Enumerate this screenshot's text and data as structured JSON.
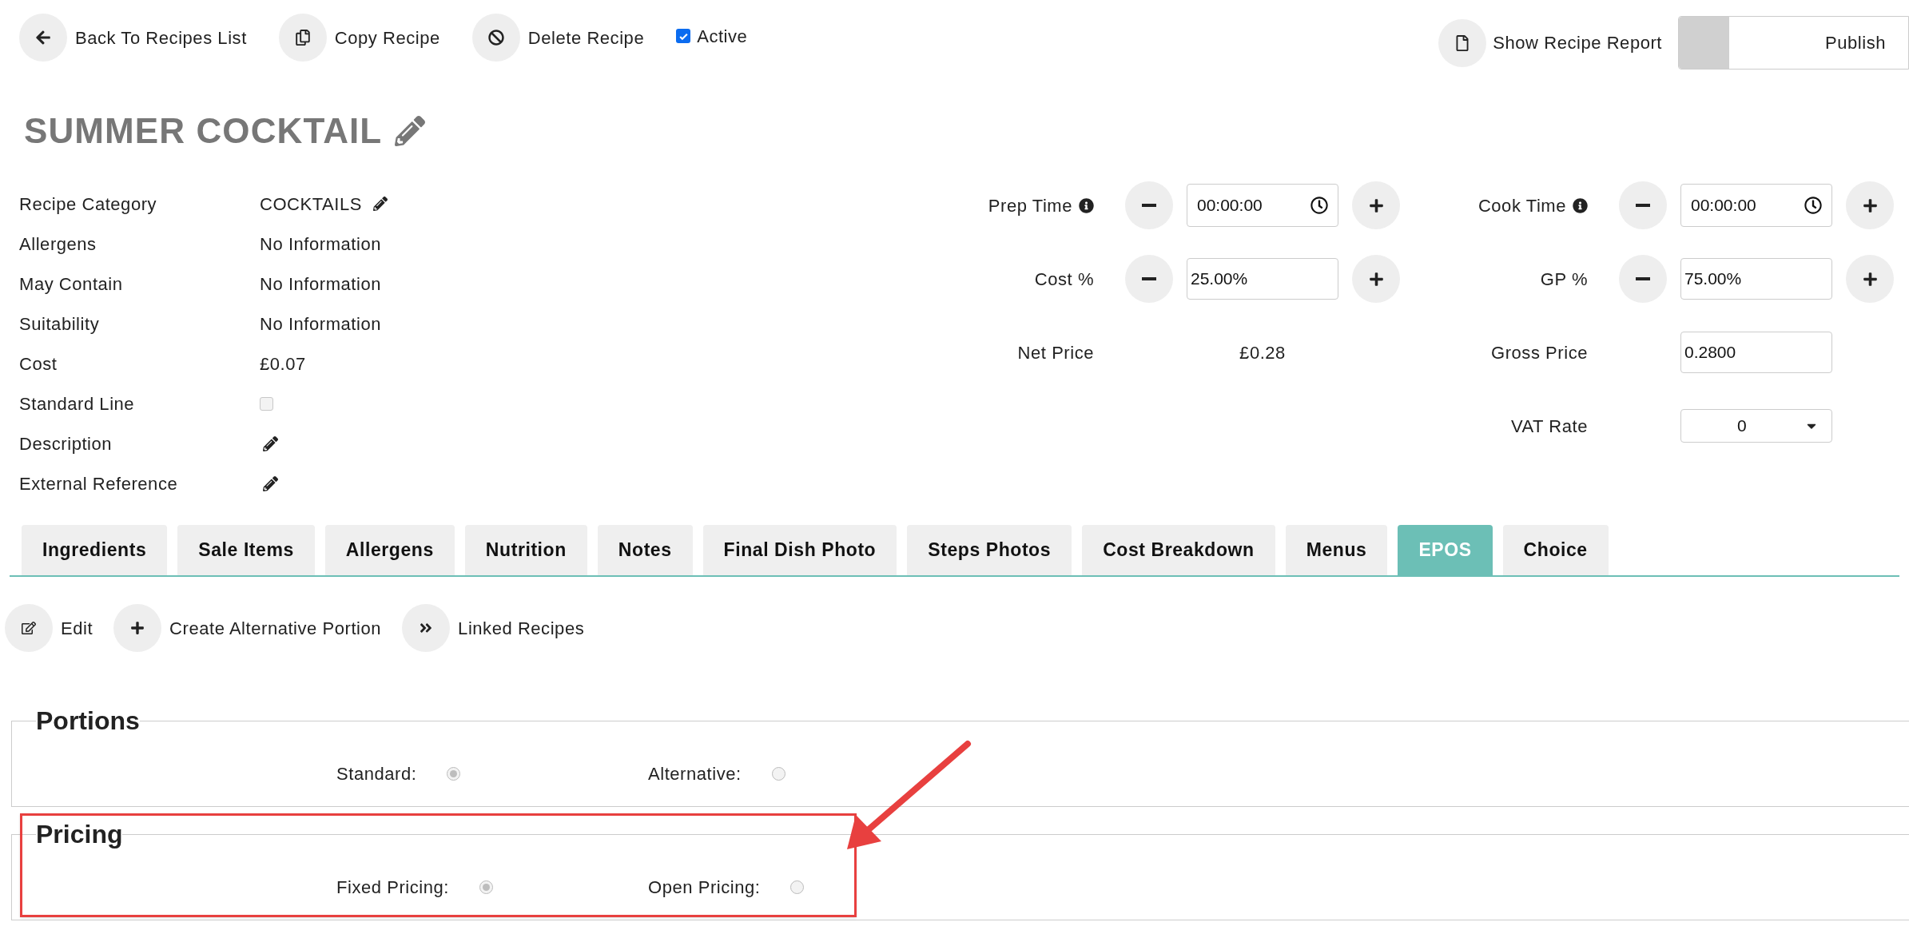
{
  "toolbar": {
    "buttons": [
      {
        "label": "Back To Recipes List"
      },
      {
        "label": "Copy Recipe"
      },
      {
        "label": "Delete Recipe"
      }
    ],
    "active": {
      "label": "Active",
      "checked": true
    },
    "report_button": {
      "label": "Show Recipe Report"
    },
    "publish_toggle": {
      "label": "Publish",
      "on": false
    }
  },
  "recipe_title": "SUMMER COCKTAIL",
  "details": [
    {
      "label": "Recipe Category",
      "kind": "text",
      "value": "COCKTAILS",
      "editable": true
    },
    {
      "label": "Allergens",
      "kind": "text",
      "value": "No Information",
      "editable": false
    },
    {
      "label": "May Contain",
      "kind": "text",
      "value": "No Information",
      "editable": false
    },
    {
      "label": "Suitability",
      "kind": "text",
      "value": "No Information",
      "editable": false
    },
    {
      "label": "Cost",
      "kind": "text",
      "value": "£0.07",
      "editable": false
    },
    {
      "label": "Standard Line",
      "kind": "checkbox",
      "checked": false
    },
    {
      "label": "Description",
      "kind": "edit"
    },
    {
      "label": "External Reference",
      "kind": "edit"
    }
  ],
  "pricing_rows": [
    {
      "left": {
        "label": "Prep Time",
        "kind": "time",
        "value": "00:00:00"
      },
      "right": {
        "label": "Cook Time",
        "kind": "time",
        "value": "00:00:00"
      }
    },
    {
      "left": {
        "label": "Cost %",
        "kind": "stepper",
        "value": "25.00%"
      },
      "right": {
        "label": "GP %",
        "kind": "stepper",
        "value": "75.00%"
      }
    },
    {
      "left": {
        "label": "Net Price",
        "kind": "readout",
        "value": "£0.28"
      },
      "right": {
        "label": "Gross Price",
        "kind": "input",
        "value": "0.2800"
      }
    },
    {
      "right": {
        "label": "VAT Rate",
        "kind": "select",
        "value": "0"
      }
    }
  ],
  "tabs": [
    {
      "label": "Ingredients",
      "selected": false
    },
    {
      "label": "Sale Items",
      "selected": false
    },
    {
      "label": "Allergens",
      "selected": false
    },
    {
      "label": "Nutrition",
      "selected": false
    },
    {
      "label": "Notes",
      "selected": false
    },
    {
      "label": "Final Dish Photo",
      "selected": false
    },
    {
      "label": "Steps Photos",
      "selected": false
    },
    {
      "label": "Cost Breakdown",
      "selected": false
    },
    {
      "label": "Menus",
      "selected": false
    },
    {
      "label": "EPOS",
      "selected": true
    },
    {
      "label": "Choice",
      "selected": false
    }
  ],
  "actions": [
    {
      "label": "Edit"
    },
    {
      "label": "Create Alternative Portion"
    },
    {
      "label": "Linked Recipes"
    }
  ],
  "sections": [
    {
      "title": "Portions",
      "options": [
        {
          "label": "Standard:",
          "selected": true
        },
        {
          "label": "Alternative:",
          "selected": false
        }
      ]
    },
    {
      "title": "Pricing",
      "options": [
        {
          "label": "Fixed Pricing:",
          "selected": true
        },
        {
          "label": "Open Pricing:",
          "selected": false
        }
      ]
    }
  ]
}
